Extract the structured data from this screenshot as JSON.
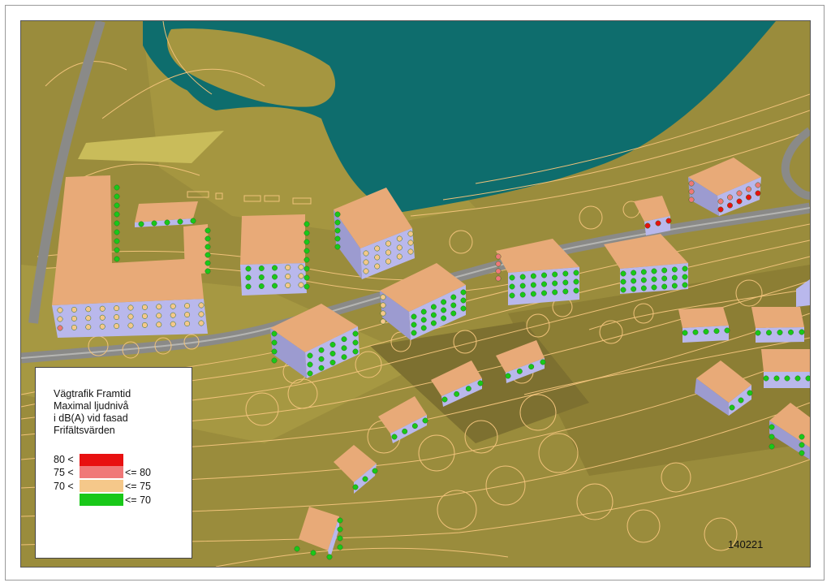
{
  "map": {
    "sheet_id": "140221",
    "colors": {
      "terrain": "#9a8c3c",
      "water": "#0e6d6d",
      "road": "#8a8a88",
      "contour": "#f0c27a",
      "roof": "#e8aa78",
      "facade": "#b9b8ec"
    }
  },
  "legend": {
    "title_lines": [
      "Vägtrafik Framtid",
      "Maximal ljudnivå",
      "i dB(A) vid fasad",
      "Frifältsvärden"
    ],
    "classes": [
      {
        "lower": "80 <",
        "upper": "",
        "color": "#e81010"
      },
      {
        "lower": "75 <",
        "upper": "<= 80",
        "color": "#f07878"
      },
      {
        "lower": "70 <",
        "upper": "<= 75",
        "color": "#f5c88a"
      },
      {
        "lower": "",
        "upper": "<= 70",
        "color": "#19c819"
      }
    ]
  }
}
